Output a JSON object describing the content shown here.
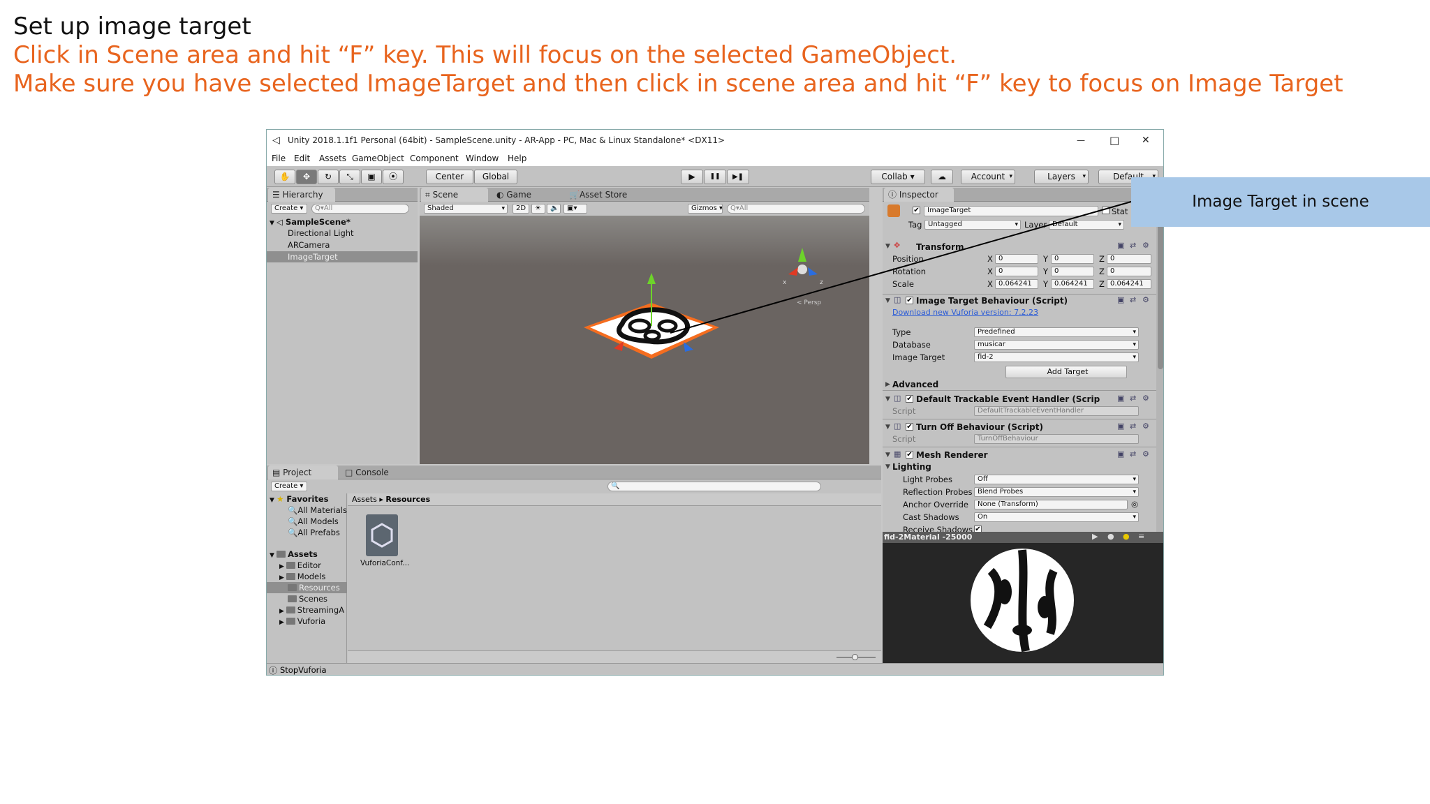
{
  "slide": {
    "title": "Set up image target",
    "line1": "Click in Scene area and hit “F” key. This will focus on the selected GameObject.",
    "line2": "Make sure you have selected ImageTarget and then click in scene area and hit “F” key to focus on Image Target",
    "accent": "#e8641e"
  },
  "callout": {
    "text": "Image Target in scene",
    "color": "#a8c8e8"
  },
  "window": {
    "title": "Unity 2018.1.1f1 Personal (64bit) - SampleScene.unity - AR-App - PC, Mac & Linux Standalone* <DX11>",
    "minimize": "—",
    "maximize": "□",
    "close": "✕"
  },
  "menu": [
    "File",
    "Edit",
    "Assets",
    "GameObject",
    "Component",
    "Window",
    "Help"
  ],
  "toolbar": {
    "tools": [
      "✋",
      "✥",
      "↻",
      "⤡",
      "▣",
      "⦿"
    ],
    "pivot_center": "Center",
    "pivot_global": "Global",
    "play": "▶",
    "pause": "❚❚",
    "step": "▶❚",
    "collab": "Collab ▾",
    "cloud": "☁",
    "account": "Account",
    "layers": "Layers",
    "layout": "Default"
  },
  "hierarchy": {
    "tab": "Hierarchy",
    "create": "Create ▾",
    "search": "Q▾All",
    "scene": "SampleScene*",
    "items": [
      "Directional Light",
      "ARCamera",
      "ImageTarget"
    ],
    "selected": "ImageTarget"
  },
  "scene": {
    "tabs": [
      "Scene",
      "Game",
      "Asset Store"
    ],
    "shading": "Shaded",
    "mode2d": "2D",
    "gizmos": "Gizmos ▾",
    "search": "Q▾All",
    "persp": "< Persp"
  },
  "project": {
    "tabs": [
      "Project",
      "Console"
    ],
    "create": "Create ▾",
    "favorites_header": "Favorites",
    "favorites": [
      "All Materials",
      "All Models",
      "All Prefabs"
    ],
    "assets_header": "Assets",
    "folders": [
      "Editor",
      "Models",
      "Resources",
      "Scenes",
      "StreamingA",
      "Vuforia"
    ],
    "selected_folder": "Resources",
    "breadcrumb": [
      "Assets",
      "Resources"
    ],
    "asset_name": "VuforiaConf...",
    "zoom": 0.5
  },
  "status": {
    "text": "StopVuforia"
  },
  "inspector": {
    "tab": "Inspector",
    "object_name": "ImageTarget",
    "static_label": "Stat",
    "tag_label": "Tag",
    "tag": "Untagged",
    "layer_label": "Layer",
    "layer": "Default",
    "transform": {
      "title": "Transform",
      "rows": [
        {
          "label": "Position",
          "x": "0",
          "y": "0",
          "z": "0"
        },
        {
          "label": "Rotation",
          "x": "0",
          "y": "0",
          "z": "0"
        },
        {
          "label": "Scale",
          "x": "0.064241",
          "y": "0.064241",
          "z": "0.064241"
        }
      ]
    },
    "itb": {
      "title": "Image Target Behaviour (Script)",
      "link": "Download new Vuforia version: 7.2.23",
      "type_label": "Type",
      "type": "Predefined",
      "db_label": "Database",
      "db": "musicar",
      "it_label": "Image Target",
      "it": "fid-2",
      "add_button": "Add Target"
    },
    "advanced": "Advanced",
    "dteh": {
      "title": "Default Trackable Event Handler (Scrip",
      "script_label": "Script",
      "script": "DefaultTrackableEventHandler"
    },
    "tob": {
      "title": "Turn Off Behaviour (Script)",
      "script_label": "Script",
      "script": "TurnOffBehaviour"
    },
    "mesh": {
      "title": "Mesh Renderer",
      "lighting": "Lighting",
      "rows": [
        {
          "label": "Light Probes",
          "value": "Off"
        },
        {
          "label": "Reflection Probes",
          "value": "Blend Probes"
        },
        {
          "label": "Anchor Override",
          "value": "None (Transform)"
        },
        {
          "label": "Cast Shadows",
          "value": "On"
        },
        {
          "label": "Receive Shadows",
          "value": "✔"
        }
      ]
    },
    "preview_label": "fid-2Material -25000"
  }
}
